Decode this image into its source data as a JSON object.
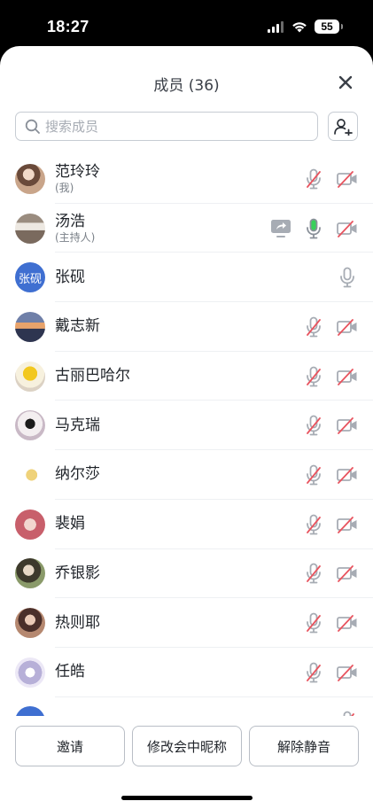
{
  "status_bar": {
    "time": "18:27",
    "battery": "55"
  },
  "header": {
    "title": "成员 (36)"
  },
  "search": {
    "placeholder": "搜索成员",
    "value": ""
  },
  "colors": {
    "accent": "#3f6fd1",
    "muted_icon": "#a7acb4",
    "red_slash": "#e8545f",
    "mic_active": "#38d05a"
  },
  "members": [
    {
      "name": "范玲玲",
      "role": "(我)",
      "mic": "muted",
      "camera": "off",
      "sharing": false,
      "avatar": "photo"
    },
    {
      "name": "汤浩",
      "role": "(主持人)",
      "mic": "active",
      "camera": "off",
      "sharing": true,
      "avatar": "photo"
    },
    {
      "name": "张砚",
      "role": "",
      "mic": "on",
      "camera": "none",
      "sharing": false,
      "avatar": "text",
      "avatar_text": "张砚"
    },
    {
      "name": "戴志新",
      "role": "",
      "mic": "muted",
      "camera": "off",
      "sharing": false,
      "avatar": "photo"
    },
    {
      "name": "古丽巴哈尔",
      "role": "",
      "mic": "muted",
      "camera": "off",
      "sharing": false,
      "avatar": "photo"
    },
    {
      "name": "马克瑞",
      "role": "",
      "mic": "muted",
      "camera": "off",
      "sharing": false,
      "avatar": "photo"
    },
    {
      "name": "纳尔莎",
      "role": "",
      "mic": "muted",
      "camera": "off",
      "sharing": false,
      "avatar": "photo"
    },
    {
      "name": "裴娟",
      "role": "",
      "mic": "muted",
      "camera": "off",
      "sharing": false,
      "avatar": "photo"
    },
    {
      "name": "乔银影",
      "role": "",
      "mic": "muted",
      "camera": "off",
      "sharing": false,
      "avatar": "photo"
    },
    {
      "name": "热则耶",
      "role": "",
      "mic": "muted",
      "camera": "off",
      "sharing": false,
      "avatar": "photo"
    },
    {
      "name": "任皓",
      "role": "",
      "mic": "muted",
      "camera": "off",
      "sharing": false,
      "avatar": "photo"
    },
    {
      "name": "",
      "role": "",
      "mic": "muted",
      "camera": "none",
      "sharing": false,
      "avatar": "text",
      "avatar_text": ""
    }
  ],
  "actions": {
    "invite": "邀请",
    "rename": "修改会中昵称",
    "unmute_all": "解除静音"
  }
}
